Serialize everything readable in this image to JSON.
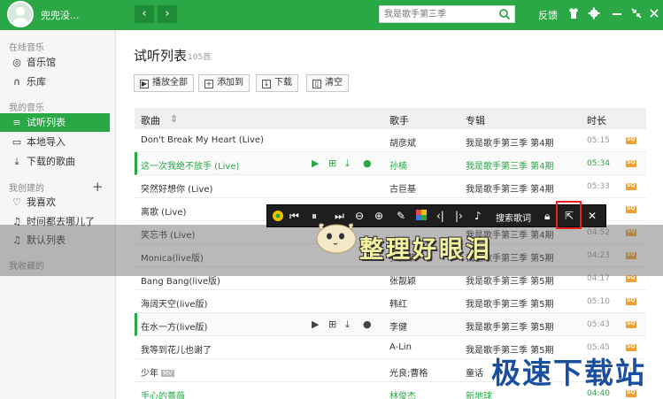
{
  "topbar": {
    "username": "兜兜没...",
    "back": "‹",
    "forward": "›",
    "search_placeholder": "我是歌手第三季",
    "feedback": "反馈",
    "icons": [
      "tshirt-icon",
      "gear-icon",
      "minimize-icon",
      "shrink-icon",
      "close-icon"
    ]
  },
  "sidebar": {
    "sections": [
      "在线音乐",
      "我的音乐",
      "我创建的",
      "我收藏的"
    ],
    "online": [
      {
        "label": "音乐馆",
        "icon": "music-hall-icon"
      },
      {
        "label": "乐库",
        "icon": "headphones-icon"
      }
    ],
    "mine": [
      {
        "label": "试听列表",
        "icon": "playlist-icon",
        "active": true
      },
      {
        "label": "本地导入",
        "icon": "monitor-icon"
      },
      {
        "label": "下载的歌曲",
        "icon": "download-icon"
      }
    ],
    "created": [
      {
        "label": "我喜欢",
        "icon": "heart-icon"
      },
      {
        "label": "时间都去哪儿了",
        "icon": "note-icon"
      },
      {
        "label": "默认列表",
        "icon": "note-icon"
      }
    ]
  },
  "main": {
    "title": "试听列表",
    "count": "105首",
    "actions": [
      "播放全部",
      "添加到",
      "下载",
      "清空"
    ],
    "columns": {
      "song": "歌曲",
      "singer": "歌手",
      "album": "专辑",
      "duration": "时长"
    },
    "rows": [
      {
        "song": "Don't Break My Heart (Live)",
        "singer": "胡彦斌",
        "album": "我是歌手第三季 第4期",
        "duration": "05:15"
      },
      {
        "song": "这一次我绝不放手 (Live)",
        "singer": "孙楠",
        "album": "我是歌手第三季 第4期",
        "duration": "05:34"
      },
      {
        "song": "突然好想你 (Live)",
        "singer": "古巨基",
        "album": "我是歌手第三季 第4期",
        "duration": "05:33"
      },
      {
        "song": "离歌 (Live)",
        "singer": "",
        "album": "",
        "duration": ""
      },
      {
        "song": "笑忘书 (Live)",
        "singer": "",
        "album": "我是歌手第三季 第4期",
        "duration": "04:52"
      },
      {
        "song": "Monica(live版)",
        "singer": "张国荣",
        "album": "我是歌手第三季 第5期",
        "duration": "04:23"
      },
      {
        "song": "Bang Bang(live版)",
        "singer": "张靓颖",
        "album": "我是歌手第三季 第5期",
        "duration": "04:17"
      },
      {
        "song": "海阔天空(live版)",
        "singer": "韩红",
        "album": "我是歌手第三季 第5期",
        "duration": "05:10"
      },
      {
        "song": "在水一方(live版)",
        "singer": "李健",
        "album": "我是歌手第三季 第5期",
        "duration": "05:43"
      },
      {
        "song": "我等到花儿也谢了",
        "singer": "A-Lin",
        "album": "我是歌手第三季 第5期",
        "duration": "05:45"
      },
      {
        "song": "少年",
        "singer": "光良;曹格",
        "album": "童话",
        "duration": "04:35",
        "mv": "MV"
      },
      {
        "song": "手心的薔薇",
        "singer": "林俊杰",
        "album": "新地球",
        "duration": "04:40"
      }
    ]
  },
  "lyric": {
    "text": "整理好眼泪",
    "search_label": "搜索歌词"
  },
  "watermark": "极速下载站",
  "colors": {
    "accent": "#2aa845",
    "sq_badge": "#f0a030",
    "highlight": "#e52424"
  }
}
